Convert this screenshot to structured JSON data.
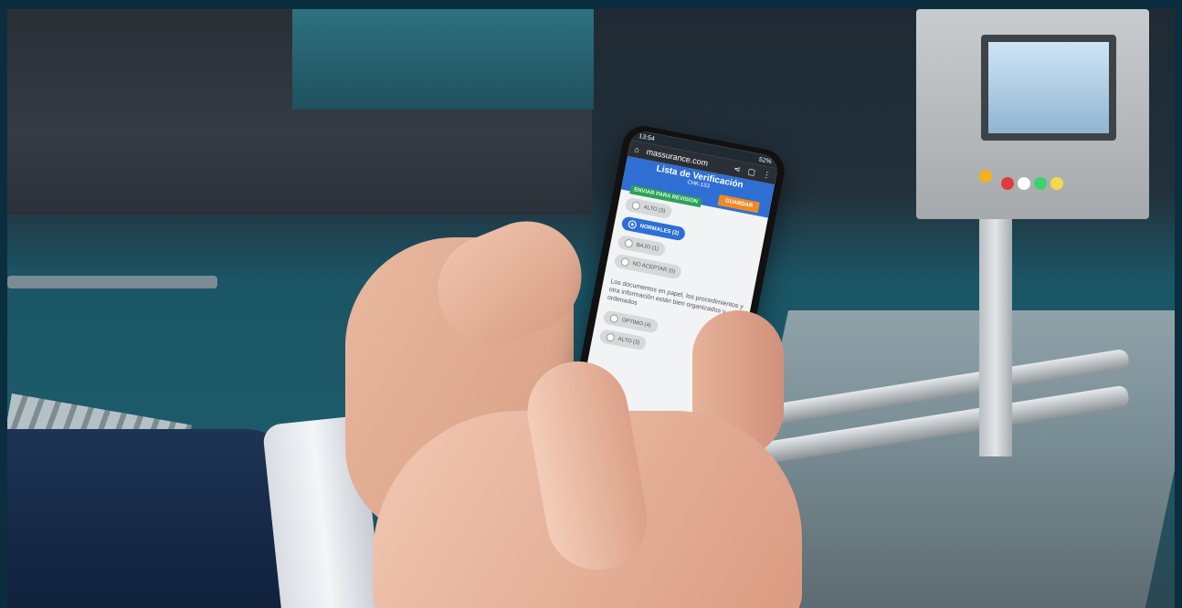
{
  "phone": {
    "status_time": "13:54",
    "status_battery": "52%",
    "url": "massurance.com",
    "app_title": "Lista de Verificación",
    "app_subtitle": "CHK-133",
    "pending_label": "ENVIAR PARA REVISION",
    "save_label": "GUARDAR",
    "options_group_1": [
      {
        "label": "ALTO (3)",
        "selected": false
      },
      {
        "label": "NORMALES (2)",
        "selected": true
      },
      {
        "label": "BAJO (1)",
        "selected": false
      },
      {
        "label": "NO ACEPTAR (0)",
        "selected": false
      }
    ],
    "question_2": "Los documentos en papel, los procedimientos y otra información están bien organizados y ordenados",
    "options_group_2": [
      {
        "label": "OPTIMO (4)",
        "selected": false
      },
      {
        "label": "ALTO (3)",
        "selected": false
      }
    ],
    "icons": {
      "home": "home-icon",
      "tabs": "tabs-icon",
      "share": "share-icon",
      "menu": "kebab-menu-icon"
    }
  }
}
